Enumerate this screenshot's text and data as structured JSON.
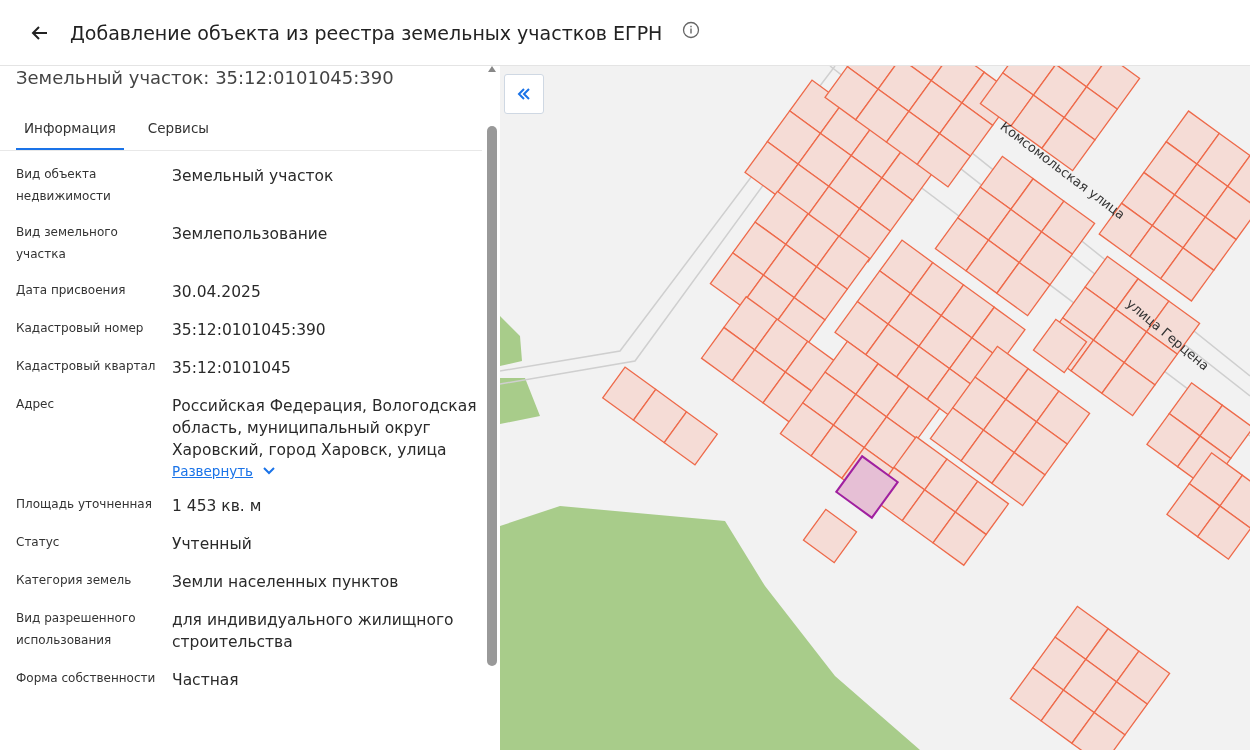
{
  "header": {
    "title": "Добавление объекта из реестра земельных участков ЕГРН"
  },
  "panel": {
    "heading": "Земельный участок: 35:12:0101045:390",
    "tabs": [
      {
        "label": "Информация",
        "selected": true
      },
      {
        "label": "Сервисы",
        "selected": false
      }
    ],
    "fields": [
      {
        "label": "Вид объекта недвижимости",
        "value": "Земельный участок"
      },
      {
        "label": "Вид земельного участка",
        "value": "Землепользование"
      },
      {
        "label": "Дата присвоения",
        "value": "30.04.2025"
      },
      {
        "label": "Кадастровый номер",
        "value": "35:12:0101045:390"
      },
      {
        "label": "Кадастровый квартал",
        "value": "35:12:0101045"
      },
      {
        "label": "Адрес",
        "value": "Российская Федерация, Вологодская область, муниципальный округ Харовский, город Харовск, улица",
        "expand_link": "Развернуть"
      },
      {
        "label": "Площадь уточненная",
        "value": "1 453 кв. м"
      },
      {
        "label": "Статус",
        "value": "Учтенный"
      },
      {
        "label": "Категория земель",
        "value": "Земли населенных пунктов"
      },
      {
        "label": "Вид разрешенного использования",
        "value": "для индивидуального жилищного строительства"
      },
      {
        "label": "Форма собственности",
        "value": "Частная"
      }
    ]
  },
  "map": {
    "street_labels": [
      "Комсомольская улица",
      "улица Герцена"
    ]
  }
}
